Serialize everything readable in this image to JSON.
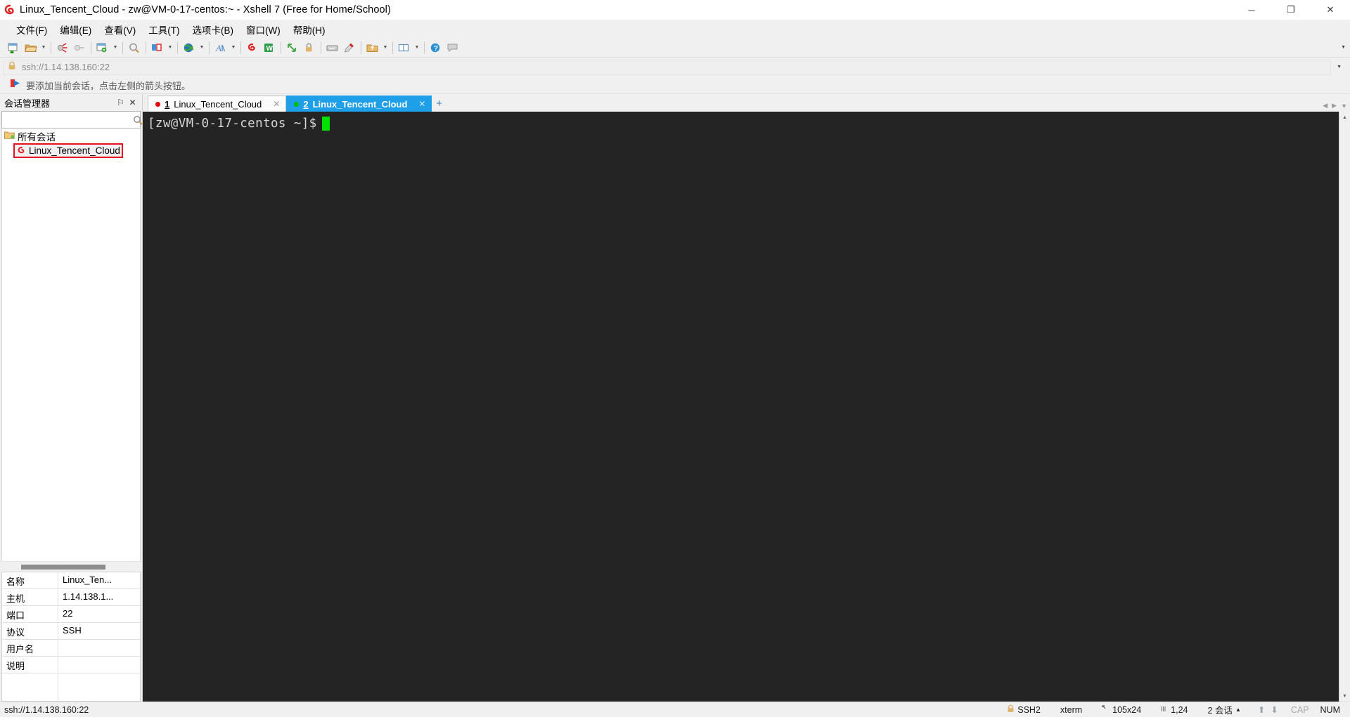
{
  "window": {
    "title": "Linux_Tencent_Cloud - zw@VM-0-17-centos:~ - Xshell 7 (Free for Home/School)",
    "app_icon": "xshell-logo-icon",
    "minimize": "─",
    "maximize": "❐",
    "close": "✕"
  },
  "menu": {
    "items": [
      {
        "label": "文件(F)",
        "name": "menu-file"
      },
      {
        "label": "编辑(E)",
        "name": "menu-edit"
      },
      {
        "label": "查看(V)",
        "name": "menu-view"
      },
      {
        "label": "工具(T)",
        "name": "menu-tools"
      },
      {
        "label": "选项卡(B)",
        "name": "menu-tabs"
      },
      {
        "label": "窗口(W)",
        "name": "menu-window"
      },
      {
        "label": "帮助(H)",
        "name": "menu-help"
      }
    ]
  },
  "toolbar": {
    "expand_caret": "▼",
    "buttons": [
      {
        "name": "new-session-icon",
        "caret": false
      },
      {
        "name": "open-folder-icon",
        "caret": true
      },
      {
        "name": "disconnect-icon",
        "caret": false
      },
      {
        "name": "reconnect-icon",
        "caret": false
      },
      {
        "name": "session-properties-icon",
        "caret": true
      },
      {
        "name": "find-icon",
        "caret": false
      },
      {
        "name": "layout-icon",
        "caret": true
      },
      {
        "name": "globe-icon",
        "caret": true
      },
      {
        "name": "font-icon",
        "caret": true
      },
      {
        "name": "log-icon",
        "caret": false
      },
      {
        "name": "excel-export-icon",
        "caret": false
      },
      {
        "name": "fullscreen-icon",
        "caret": false
      },
      {
        "name": "lock-icon",
        "caret": false
      },
      {
        "name": "keyboard-icon",
        "caret": false
      },
      {
        "name": "highlight-icon",
        "caret": false
      },
      {
        "name": "transfer-icon",
        "caret": true
      },
      {
        "name": "split-view-icon",
        "caret": true
      },
      {
        "name": "help-icon",
        "caret": false
      },
      {
        "name": "chat-icon",
        "caret": false
      }
    ]
  },
  "address_bar": {
    "lock_icon": "lock-icon",
    "url": "ssh://1.14.138.160:22",
    "dropdown_caret": "▼"
  },
  "notification": {
    "icon": "arrow-hint-icon",
    "text": "要添加当前会话，点击左侧的箭头按钮。"
  },
  "sidebar": {
    "title": "会话管理器",
    "pin_label": "⚐",
    "close_label": "✕",
    "search": {
      "value": "",
      "placeholder": "",
      "icon": "search-icon"
    },
    "tree": {
      "root": {
        "label": "所有会话",
        "icon": "folder-sessions-icon"
      },
      "children": [
        {
          "label": "Linux_Tencent_Cloud",
          "icon": "session-icon",
          "selected": true,
          "highlighted": true
        }
      ]
    },
    "properties": {
      "rows": [
        {
          "key": "名称",
          "value": "Linux_Ten..."
        },
        {
          "key": "主机",
          "value": "1.14.138.1..."
        },
        {
          "key": "端口",
          "value": "22"
        },
        {
          "key": "协议",
          "value": "SSH"
        },
        {
          "key": "用户名",
          "value": ""
        },
        {
          "key": "说明",
          "value": ""
        }
      ]
    }
  },
  "tabs": {
    "items": [
      {
        "num": "1",
        "label": "Linux_Tencent_Cloud",
        "dot_color": "#e00000",
        "active": false,
        "close": "✕"
      },
      {
        "num": "2",
        "label": "Linux_Tencent_Cloud",
        "dot_color": "#00c000",
        "active": true,
        "close": "✕"
      }
    ],
    "add_label": "+",
    "scroll_left": "◀",
    "scroll_right": "▶",
    "menu_caret": "▼"
  },
  "terminal": {
    "prompt": "[zw@VM-0-17-centos ~]$",
    "cursor_color": "#00e000",
    "background": "#242424",
    "foreground": "#d6d6d6",
    "scroll_up": "▲",
    "scroll_down": "▼"
  },
  "status_bar": {
    "url": "ssh://1.14.138.160:22",
    "protocol": "SSH2",
    "protocol_icon": "lock-icon",
    "terminal_type": "xterm",
    "size": "105x24",
    "size_icon": "screen-size-icon",
    "cursor_pos": "1,24",
    "cursor_icon": "cursor-pos-icon",
    "sessions": "2 会话",
    "sessions_caret": "▲",
    "up_arrow": "⬆",
    "down_arrow": "⬇",
    "cap": "CAP",
    "num": "NUM"
  }
}
